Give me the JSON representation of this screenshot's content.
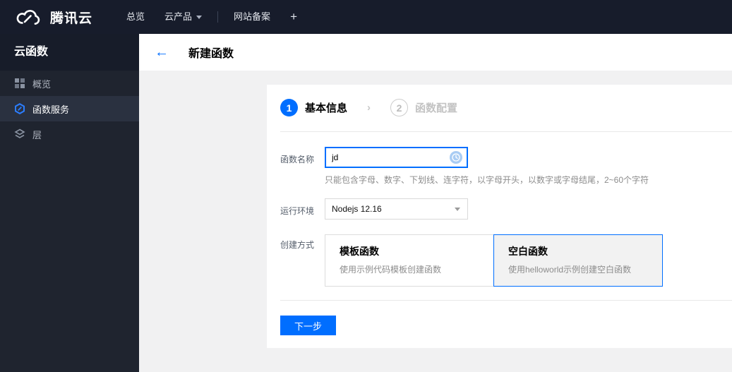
{
  "topbar": {
    "brand": "腾讯云",
    "items": [
      {
        "label": "总览"
      },
      {
        "label": "云产品"
      },
      {
        "label": "网站备案"
      },
      {
        "label": "+"
      }
    ]
  },
  "sidebar": {
    "title": "云函数",
    "items": [
      {
        "label": "概览",
        "icon": "grid-icon",
        "selected": false
      },
      {
        "label": "函数服务",
        "icon": "hexagon-function-icon",
        "selected": true
      },
      {
        "label": "层",
        "icon": "layers-icon",
        "selected": false
      }
    ]
  },
  "header": {
    "back": "←",
    "title": "新建函数"
  },
  "wizard": {
    "separator": "›",
    "steps": [
      {
        "number": "1",
        "label": "基本信息",
        "active": true
      },
      {
        "number": "2",
        "label": "函数配置",
        "active": false
      }
    ]
  },
  "form": {
    "name": {
      "label": "函数名称",
      "value": "jd",
      "hint": "只能包含字母、数字、下划线、连字符，以字母开头，以数字或字母结尾，2~60个字符"
    },
    "runtime": {
      "label": "运行环境",
      "value": "Nodejs 12.16"
    },
    "method": {
      "label": "创建方式",
      "options": [
        {
          "title": "模板函数",
          "desc": "使用示例代码模板创建函数",
          "selected": false
        },
        {
          "title": "空白函数",
          "desc": "使用helloworld示例创建空白函数",
          "selected": true
        }
      ]
    },
    "next_button": "下一步"
  },
  "colors": {
    "accent": "#006eff",
    "topbar_bg": "#171c2b",
    "sidebar_bg": "#1f242f",
    "sidebar_selected_bg": "#2a3140",
    "content_bg": "#f1f1f2"
  }
}
